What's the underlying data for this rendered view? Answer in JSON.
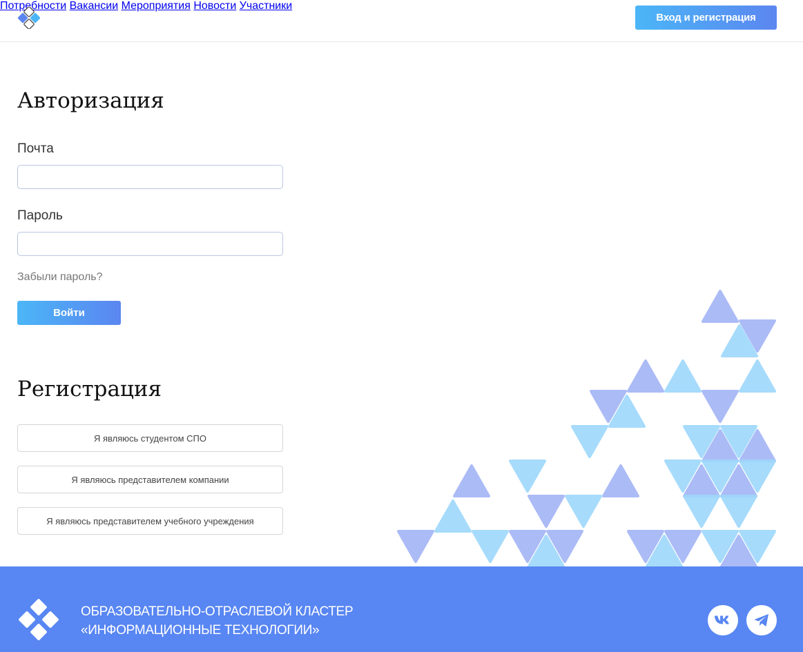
{
  "header": {
    "nav": [
      "Потребности",
      "Вакансии",
      "Мероприятия",
      "Новости",
      "Участники"
    ],
    "login_button": "Вход и регистрация"
  },
  "auth": {
    "title": "Авторизация",
    "email_label": "Почта",
    "email_value": "",
    "password_label": "Пароль",
    "password_value": "",
    "forgot_link": "Забыли пароль?",
    "submit_button": "Войти"
  },
  "registration": {
    "title": "Регистрация",
    "options": [
      "Я являюсь студентом СПО",
      "Я являюсь представителем компании",
      "Я являюсь представителем учебного учреждения"
    ]
  },
  "footer": {
    "title_line1": "ОБРАЗОВАТЕЛЬНО-ОТРАСЛЕВОЙ КЛАСТЕР",
    "title_line2": "«ИНФОРМАЦИОННЫЕ ТЕХНОЛОГИИ»",
    "social": [
      "vk-icon",
      "telegram-icon"
    ]
  },
  "colors": {
    "accent_start": "#4bb6f7",
    "accent_end": "#5b86f0",
    "footer_bg": "#5886f2",
    "triangle_light": "#9fd8fb",
    "triangle_violet": "#a4b6f6"
  }
}
